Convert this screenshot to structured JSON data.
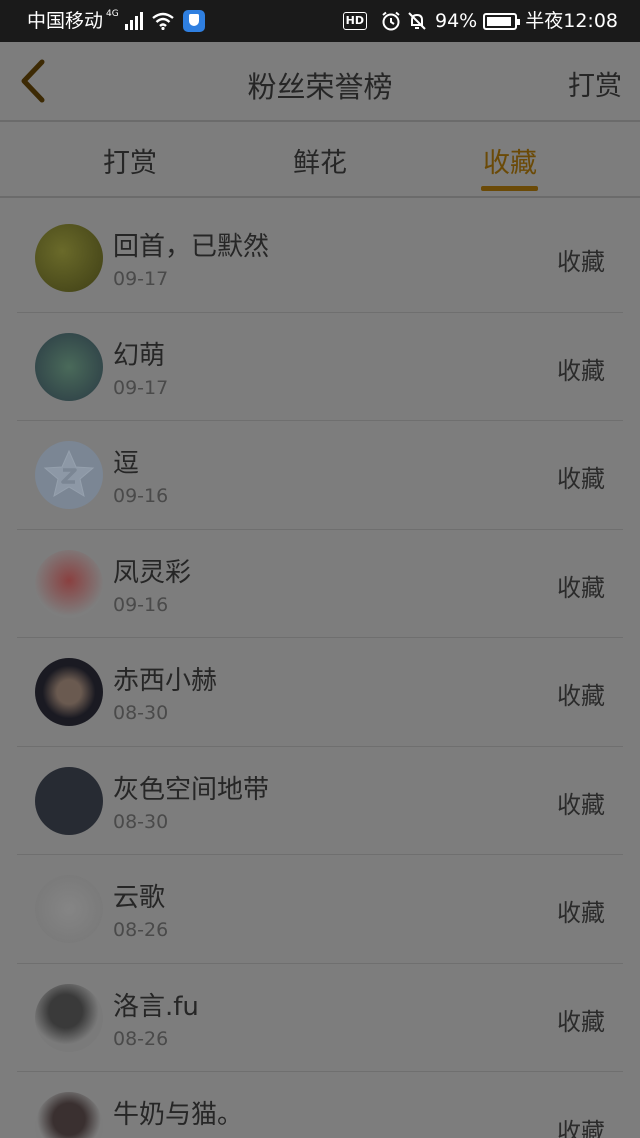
{
  "status_bar": {
    "carrier": "中国移动",
    "network": "4G",
    "battery": "94%",
    "battery_level": 0.94,
    "time": "半夜12:08",
    "hd_label": "HD"
  },
  "nav": {
    "title": "粉丝荣誉榜",
    "right_action": "打赏",
    "back_icon": "chevron-left-icon"
  },
  "tabs": [
    {
      "label": "打赏",
      "active": false
    },
    {
      "label": "鲜花",
      "active": false
    },
    {
      "label": "收藏",
      "active": true
    }
  ],
  "colors": {
    "accent": "#6b4a07",
    "overlay_bg": "#7d7d7d",
    "status_bar_bg": "#1a1a1a"
  },
  "fans": [
    {
      "name": "回首，已默然",
      "date": "09-17",
      "action": "收藏"
    },
    {
      "name": "幻萌",
      "date": "09-17",
      "action": "收藏"
    },
    {
      "name": "逗",
      "date": "09-16",
      "action": "收藏"
    },
    {
      "name": "凤灵彩",
      "date": "09-16",
      "action": "收藏"
    },
    {
      "name": "赤西小赫",
      "date": "08-30",
      "action": "收藏"
    },
    {
      "name": "灰色空间地带",
      "date": "08-30",
      "action": "收藏"
    },
    {
      "name": "云歌",
      "date": "08-26",
      "action": "收藏"
    },
    {
      "name": "洛言.fu",
      "date": "08-26",
      "action": "收藏"
    },
    {
      "name": "牛奶与猫。",
      "date": "",
      "action": "收藏"
    }
  ]
}
